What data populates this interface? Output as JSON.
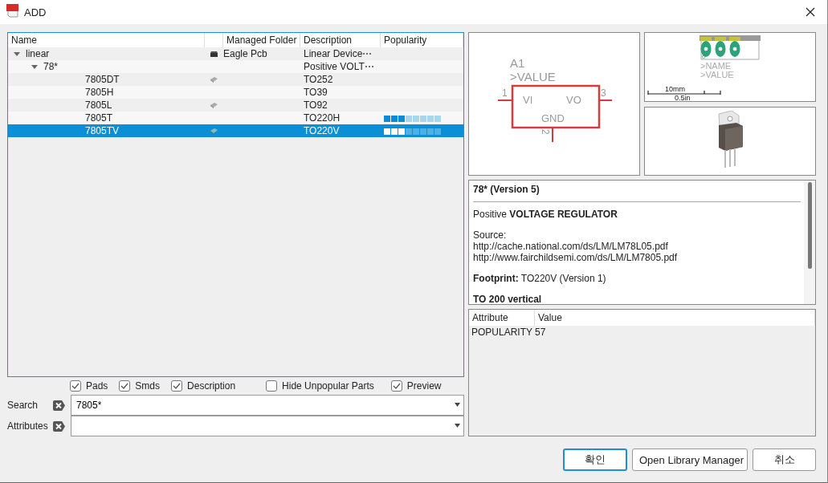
{
  "window": {
    "title": "ADD"
  },
  "tree": {
    "columns": [
      "Name",
      "Managed Folder",
      "Description",
      "Popularity"
    ],
    "rows": [
      {
        "name": "linear",
        "expanded": true,
        "kind": "library",
        "folder": "Eagle Pcb",
        "description": "Linear Device⋯",
        "selected": false,
        "children": [
          {
            "name": "78*",
            "expanded": true,
            "description": "Positive VOLT⋯",
            "selected": false,
            "children": [
              {
                "name": "7805DT",
                "kind": "package",
                "description": "TO252",
                "selected": false
              },
              {
                "name": "7805H",
                "description": "TO39",
                "selected": false
              },
              {
                "name": "7805L",
                "kind": "package",
                "description": "TO92",
                "selected": false
              },
              {
                "name": "7805T",
                "description": "TO220H",
                "level": 0.375,
                "selected": false
              },
              {
                "name": "7805TV",
                "kind": "package",
                "description": "TO220V",
                "level": 0.375,
                "selected": true
              }
            ]
          }
        ]
      }
    ]
  },
  "filters": [
    {
      "label": "Pads",
      "checked": true
    },
    {
      "label": "Smds",
      "checked": true
    },
    {
      "label": "Description",
      "checked": true
    },
    {
      "label": "Hide Unpopular Parts",
      "checked": false
    },
    {
      "label": "Preview",
      "checked": true
    }
  ],
  "search": {
    "label": "Search",
    "value": "7805*"
  },
  "attributes_filter": {
    "label": "Attributes"
  },
  "symbol": {
    "name": "A1",
    "value": ">VALUE",
    "pins": [
      "1",
      "3",
      "2"
    ],
    "pin_names": [
      "VI",
      "VO",
      "GND"
    ]
  },
  "package": {
    "labels": [
      ">NAME",
      ">VALUE"
    ],
    "scale": [
      "10mm",
      "0.5in"
    ]
  },
  "description": [
    {
      "kind": "heading",
      "text": "78* (Version 5)"
    },
    {
      "kind": "text",
      "text": "Positive **VOLTAGE REGULATOR**"
    },
    {
      "kind": "lines",
      "lines": [
        "Source:",
        "http://cache.national.com/ds/LM/LM78L05.pdf",
        "http://www.fairchildsemi.com/ds/LM/LM7805.pdf"
      ]
    },
    {
      "kind": "text",
      "text": "**Footprint:** TO220V (Version 1)"
    },
    {
      "kind": "heading",
      "text": "TO 200 vertical"
    }
  ],
  "attribute_table": {
    "columns": [
      "Attribute",
      "Value"
    ],
    "rows": [
      [
        "POPULARITY",
        "57"
      ]
    ]
  },
  "buttons": [
    {
      "label": "확인",
      "default": true
    },
    {
      "label": "Open Library Manager",
      "default": false
    },
    {
      "label": "취소",
      "default": false
    }
  ]
}
